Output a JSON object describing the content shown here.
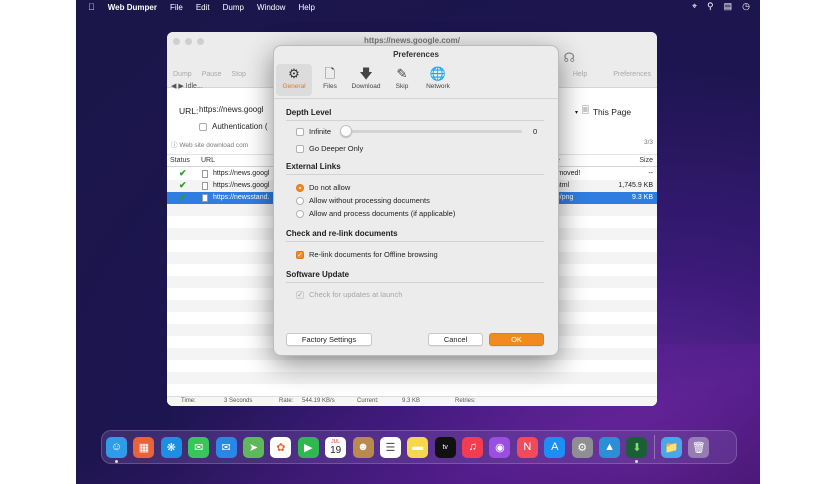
{
  "menubar": {
    "apple": "",
    "app_name": "Web Dumper",
    "items": [
      "File",
      "Edit",
      "Dump",
      "Window",
      "Help"
    ]
  },
  "main_window": {
    "title": "https://news.google.com/",
    "toolbar_left": [
      "Dump",
      "Pause",
      "Stop"
    ],
    "toolbar_right": [
      "Help",
      "Preferences"
    ],
    "idle_text": "◀ ▶ Idle...",
    "url_label": "URL:",
    "url_value": "https://news.googl",
    "auth_label": "Authentication (",
    "page_select": "This Page",
    "status_line": "Web site download com",
    "progress_fraction": "3/3",
    "columns": {
      "status": "Status",
      "url": "URL",
      "type": "pe",
      "size": "Size"
    },
    "rows": [
      {
        "url": "https://news.googl",
        "type": "s moved!",
        "size": "--"
      },
      {
        "url": "https://news.googl",
        "type": "t/html",
        "size": "1,745.9 KB"
      },
      {
        "url": "https://newsstand.",
        "type": "ge/png",
        "size": "9.3 KB"
      }
    ],
    "footer": {
      "time_label": "Time:",
      "time_value": "3  Seconds",
      "rate_label": "Rate:",
      "rate_value": "544.19  KB/s",
      "current_label": "Current:",
      "current_value": "9.3  KB",
      "retries_label": "Retries:"
    }
  },
  "preferences": {
    "title": "Preferences",
    "tabs": [
      {
        "label": "General",
        "icon": "gear-icon"
      },
      {
        "label": "Files",
        "icon": "files-icon"
      },
      {
        "label": "Download",
        "icon": "download-arrow-icon"
      },
      {
        "label": "Skip",
        "icon": "broom-icon"
      },
      {
        "label": "Network",
        "icon": "globe-icon"
      }
    ],
    "depth_level": {
      "heading": "Depth Level",
      "infinite_label": "Infinite",
      "slider_value": "0",
      "go_deeper_label": "Go Deeper Only"
    },
    "external_links": {
      "heading": "External Links",
      "options": [
        "Do not allow",
        "Allow without processing documents",
        "Allow and process documents (if applicable)"
      ]
    },
    "relink": {
      "heading": "Check and re-link documents",
      "option": "Re-link documents for Offline browsing"
    },
    "software_update": {
      "heading": "Software Update",
      "option": "Check for updates at launch"
    },
    "buttons": {
      "factory": "Factory Settings",
      "cancel": "Cancel",
      "ok": "OK"
    }
  },
  "dock": {
    "calendar_month": "JUL",
    "calendar_day": "19",
    "tv_label": "tv"
  },
  "colors": {
    "accent": "#f28a22",
    "selection": "#2f7de1"
  }
}
